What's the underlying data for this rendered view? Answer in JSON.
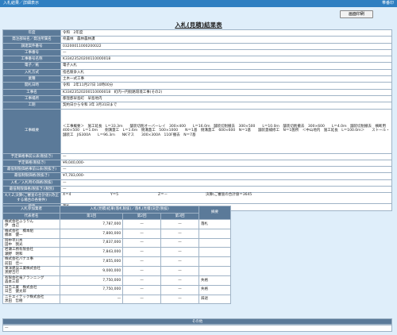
{
  "header": {
    "left": "入札結果／詳細表示",
    "right": "帯番印"
  },
  "print_button": "画面印刷",
  "title": "入札(見積)結果表",
  "info_rows": [
    {
      "label": "年度",
      "value": "令和　2年度"
    },
    {
      "label": "発注部局名／発注所属名",
      "value": "県農林　農林農林課"
    },
    {
      "label": "調達案件番号",
      "value": "03200011000200022"
    },
    {
      "label": "工事番号",
      "value": "—"
    },
    {
      "label": "工事番号名称",
      "value": "K33423520200110000018"
    },
    {
      "label": "電子／紙",
      "value": "電子入札"
    },
    {
      "label": "入札方式",
      "value": "指名競争入札"
    },
    {
      "label": "業種",
      "value": "土木一式工事"
    },
    {
      "label": "開札日時",
      "value": "令和　2年11月27日 10時00分"
    },
    {
      "label": "工事名",
      "value": "K33423520200110000018　町内一円街路環境工事(その2)"
    },
    {
      "label": "工事場所",
      "value": "都窪郡早島町　早島地内"
    },
    {
      "label": "工期",
      "value": "契約日から令和 3年 3月31日まで"
    },
    {
      "label": "工事概要",
      "value": "＜工事概要＞　施工延長　L＝33.3ｍ　　舗装切削オーバーレイ　300×400　　L＝16.0ｍ　舗装切削撤去　300×500　　L＝10.0ｍ　舗装切削撤去　300×600　　L＝4.0ｍ　舗装切削撤去　横断用　400×500　L＝1.0ｍ　　側溝蓋工　L＝1.6ｍ　側溝蓋工　500×1000　　N＝1基　側溝蓋工　600×600　N＝1基　　舗装蓋補修工　N＝1箇所　＜中山地内　施工延長　L＝100.0ｍ＞　　ストール・舗装工　JIS300A　　L＝96.3ｍ　　NKマス　　300×300A　110F撤去　N＝7基"
    },
    {
      "label": "予定価格事前公表(税抜き)",
      "value": "—"
    },
    {
      "label": "予定価格(税抜き)",
      "value": "¥9,040,000-"
    },
    {
      "label": "最低制限価格事前公表(税抜き)",
      "value": "—"
    },
    {
      "label": "最低制限価格(税抜き)",
      "value": "¥7,783,000-"
    },
    {
      "label": "入札／入札時の価格(税抜)",
      "value": "—"
    },
    {
      "label": "最低制限価格(税抜き)(税別)",
      "value": "—"
    }
  ],
  "coef": {
    "label": "X,Y,Z,決算(ご審査の合計値)(改正する場合の各要件)",
    "x": "X＝4",
    "y": "Y＝5",
    "z": "Z＝－",
    "total": "決算(ご審査の合計値＝3645"
  },
  "remark_row": {
    "label": "摘要",
    "value": "落札"
  },
  "bids": {
    "h_company": "入札参加業者",
    "h_group": "入札(見積)結果(落札税抜)／落札(見積)決定(税抜)",
    "h_round1": "第1回",
    "h_round2": "第2回",
    "h_round3": "第3回",
    "h_remark": "摘要",
    "h_name": "代表者名",
    "rows": [
      {
        "company": "株式会社ふうりん",
        "rep": "伊　由己",
        "r1": "7,787,000",
        "r2": "—",
        "r3": "—",
        "remark": "落札"
      },
      {
        "company": "株式会社　橋本組",
        "rep": "橋本　健一",
        "r1": "7,800,000",
        "r2": "—",
        "r3": "—",
        "remark": ""
      },
      {
        "company": "岡中平川木",
        "rep": "田中　我光",
        "r1": "7,837,000",
        "r2": "—",
        "r3": "—",
        "remark": ""
      },
      {
        "company": "岩瀬工務有限会社",
        "rep": "瀬野　明和",
        "r1": "7,843,000",
        "r2": "—",
        "r3": "—",
        "remark": ""
      },
      {
        "company": "株式会社パナエ事",
        "rep": "前田　佳一",
        "r1": "7,855,000",
        "r2": "—",
        "r3": "—",
        "remark": ""
      },
      {
        "company": "東洋建設工業株式会社",
        "rep": "黒野吉行",
        "r1": "9,000,000",
        "r2": "—",
        "r3": "—",
        "remark": ""
      },
      {
        "company": "有限会社竜アランニング",
        "rep": "森本三郎",
        "r1": "7,750,000",
        "r2": "—",
        "r3": "—",
        "remark": "失格"
      },
      {
        "company": "日吉工業　株式会社",
        "rep": "日吉　健太郎",
        "r1": "7,750,000",
        "r2": "—",
        "r3": "—",
        "remark": "失格"
      },
      {
        "company": "ニチエイテック株式会社",
        "rep": "黒田　哲樹",
        "r1": "—",
        "r2": "—",
        "r3": "—",
        "remark": "辞退"
      }
    ]
  },
  "sonota": {
    "label": "その他",
    "value": "—"
  }
}
